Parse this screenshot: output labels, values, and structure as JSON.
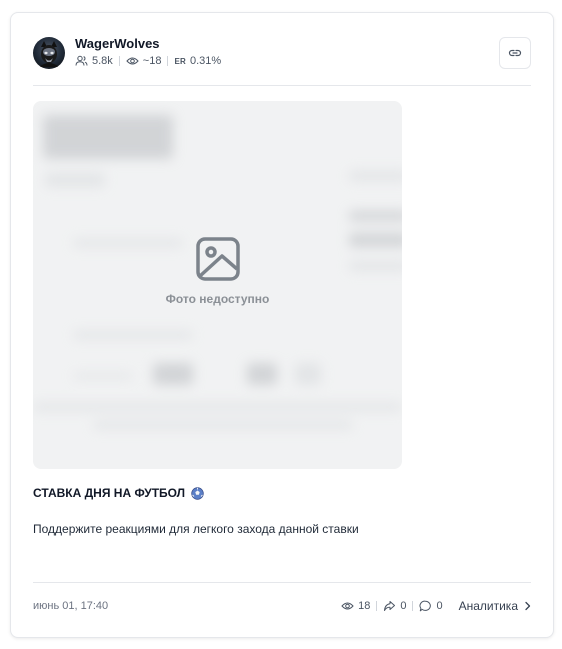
{
  "channel": {
    "name": "WagerWolves",
    "subscribers": "5.8k",
    "views": "~18",
    "er_tag": "ER",
    "er_value": "0.31%"
  },
  "media": {
    "unavailable_text": "Фото недоступно"
  },
  "post": {
    "title": "СТАВКА ДНЯ НА ФУТБОЛ",
    "title_emoji": "soccer-ball-icon",
    "text": "Поддержите реакциями для легкого захода данной ставки"
  },
  "footer": {
    "date": "июнь 01, 17:40",
    "views": "18",
    "shares": "0",
    "comments": "0",
    "analytics_label": "Аналитика"
  },
  "icons": {
    "subscribers": "users-icon",
    "views": "eye-icon",
    "link": "link-icon",
    "image": "image-icon",
    "share": "share-icon",
    "comment": "comment-icon",
    "chevron": "chevron-right-icon"
  },
  "colors": {
    "border": "#e5e7eb",
    "text": "#111827",
    "muted": "#6b7280",
    "placeholder_bg": "#f1f2f3",
    "placeholder_icon": "#7c838b"
  }
}
